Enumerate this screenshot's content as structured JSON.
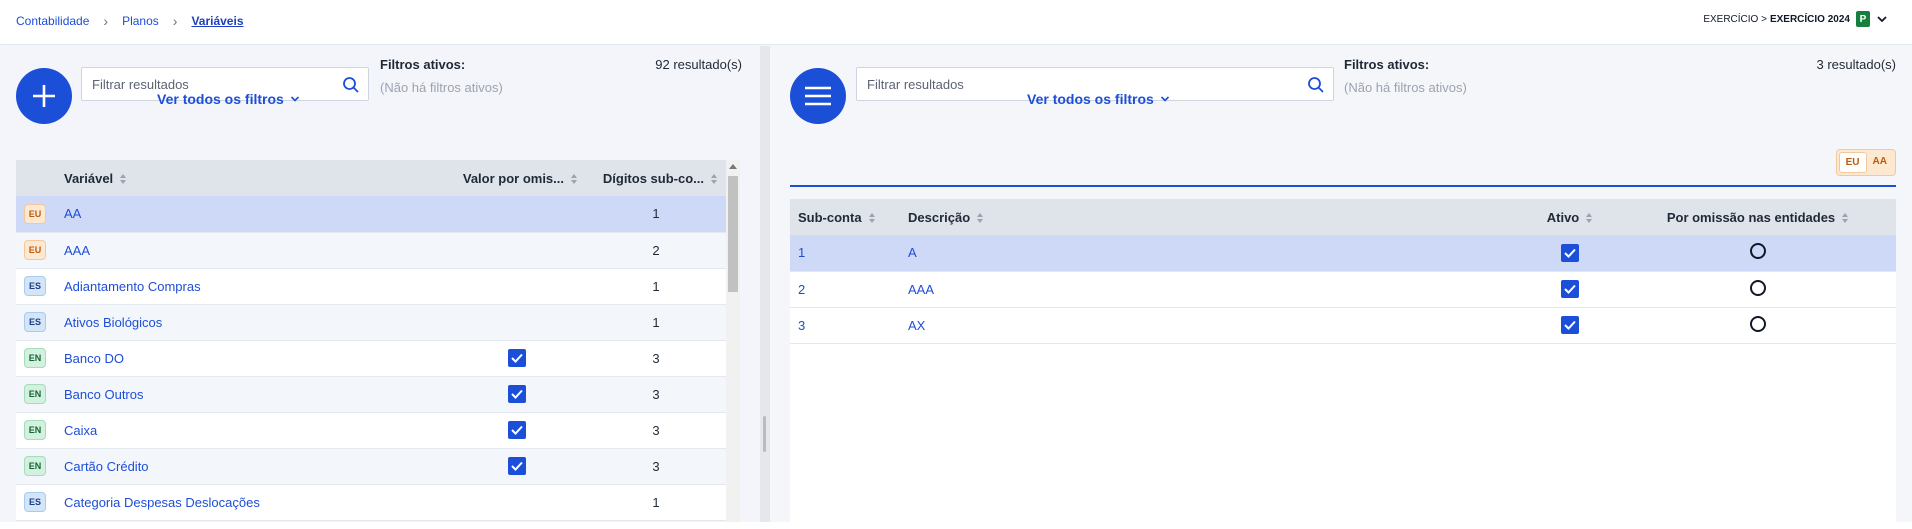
{
  "breadcrumb": {
    "items": [
      "Contabilidade",
      "Planos"
    ],
    "current": "Variáveis"
  },
  "exercise": {
    "prefix": "EXERCÍCIO >",
    "label": "EXERCÍCIO 2024",
    "badge": "P"
  },
  "left": {
    "search_placeholder": "Filtrar resultados",
    "filters_link": "Ver todos os filtros",
    "active_filters_title": "Filtros ativos:",
    "active_filters_none": "(Não há filtros ativos)",
    "results": "92 resultado(s)",
    "columns": [
      "Variável",
      "Valor por omis...",
      "Dígitos sub-co..."
    ],
    "rows": [
      {
        "tag": "EU",
        "name": "AA",
        "default": false,
        "digits": "1"
      },
      {
        "tag": "EU",
        "name": "AAA",
        "default": false,
        "digits": "2"
      },
      {
        "tag": "ES",
        "name": "Adiantamento Compras",
        "default": false,
        "digits": "1"
      },
      {
        "tag": "ES",
        "name": "Ativos Biológicos",
        "default": false,
        "digits": "1"
      },
      {
        "tag": "EN",
        "name": "Banco DO",
        "default": true,
        "digits": "3"
      },
      {
        "tag": "EN",
        "name": "Banco Outros",
        "default": true,
        "digits": "3"
      },
      {
        "tag": "EN",
        "name": "Caixa",
        "default": true,
        "digits": "3"
      },
      {
        "tag": "EN",
        "name": "Cartão Crédito",
        "default": true,
        "digits": "3"
      },
      {
        "tag": "ES",
        "name": "Categoria Despesas Deslocações",
        "default": false,
        "digits": "1"
      }
    ]
  },
  "right": {
    "search_placeholder": "Filtrar resultados",
    "filters_link": "Ver todos os filtros",
    "active_filters_title": "Filtros ativos:",
    "active_filters_none": "(Não há filtros ativos)",
    "results": "3 resultado(s)",
    "toggle": [
      "EU",
      "AA"
    ],
    "columns": [
      "Sub-conta",
      "Descrição",
      "Ativo",
      "Por omissão nas entidades"
    ],
    "rows": [
      {
        "sub": "1",
        "desc": "A",
        "active": true,
        "default": false
      },
      {
        "sub": "2",
        "desc": "AAA",
        "active": true,
        "default": false
      },
      {
        "sub": "3",
        "desc": "AX",
        "active": true,
        "default": false
      }
    ]
  },
  "icons": {
    "add": "plus-icon",
    "menu": "menu-icon",
    "search": "search-icon",
    "sort": "sort-icon",
    "chevron": "chevron-down-icon"
  },
  "colors": {
    "primary": "#1c4fd8",
    "selected_row": "#cdd9f7",
    "badge_green": "#15803d"
  }
}
